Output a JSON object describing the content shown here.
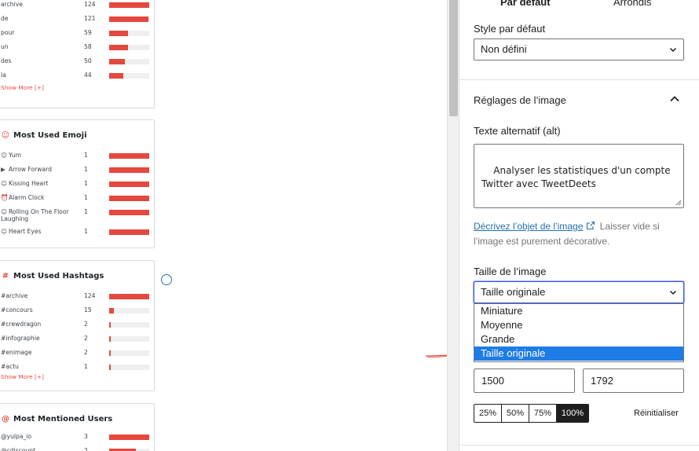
{
  "canvas": {
    "cards": [
      {
        "title": "",
        "rows": [
          {
            "icon": "",
            "label": "archive",
            "count": "124",
            "fill": 1.0
          },
          {
            "icon": "",
            "label": "de",
            "count": "121",
            "fill": 0.98
          },
          {
            "icon": "",
            "label": "pour",
            "count": "59",
            "fill": 0.48
          },
          {
            "icon": "",
            "label": "un",
            "count": "58",
            "fill": 0.47
          },
          {
            "icon": "",
            "label": "des",
            "count": "50",
            "fill": 0.4
          },
          {
            "icon": "",
            "label": "la",
            "count": "44",
            "fill": 0.36
          }
        ],
        "show_more": "Show More [+]"
      },
      {
        "title": "Most Used Emoji",
        "title_icon": "☺",
        "rows": [
          {
            "icon": "☺",
            "label": "Yum",
            "count": "1",
            "fill": 1.0
          },
          {
            "icon": "▶",
            "label": "Arrow Forward",
            "count": "1",
            "fill": 1.0
          },
          {
            "icon": "☺",
            "label": "Kissing Heart",
            "count": "1",
            "fill": 1.0
          },
          {
            "icon": "⏰",
            "label": "Alarm Clock",
            "count": "1",
            "fill": 1.0
          },
          {
            "icon": "☺",
            "label": "Rolling On The Floor Laughing",
            "count": "1",
            "fill": 1.0
          },
          {
            "icon": "☺",
            "label": "Heart Eyes",
            "count": "1",
            "fill": 1.0
          }
        ],
        "show_more": ""
      },
      {
        "title": "Most Used Hashtags",
        "title_icon": "#",
        "rows": [
          {
            "icon": "",
            "label": "#archive",
            "count": "124",
            "fill": 1.0
          },
          {
            "icon": "",
            "label": "#concours",
            "count": "15",
            "fill": 0.12
          },
          {
            "icon": "",
            "label": "#crewdragon",
            "count": "2",
            "fill": 0.03
          },
          {
            "icon": "",
            "label": "#infographie",
            "count": "2",
            "fill": 0.03
          },
          {
            "icon": "",
            "label": "#enimage",
            "count": "2",
            "fill": 0.03
          },
          {
            "icon": "",
            "label": "#actu",
            "count": "1",
            "fill": 0.02
          }
        ],
        "show_more": "Show More [+]"
      },
      {
        "title": "Most Mentioned Users",
        "title_icon": "@",
        "rows": [
          {
            "icon": "",
            "label": "@yulpa_io",
            "count": "3",
            "fill": 1.0
          },
          {
            "icon": "",
            "label": "@cdiscount",
            "count": "2",
            "fill": 0.67
          }
        ],
        "show_more": ""
      }
    ]
  },
  "sidebar": {
    "tabs": {
      "active": "Par défaut",
      "inactive": "Arrondis"
    },
    "style": {
      "label": "Style par défaut",
      "value": "Non défini"
    },
    "panel": {
      "title": "Réglages de l’image",
      "alt_label": "Texte alternatif (alt)",
      "alt_value": "Analyser les statistiques d'un compte Twitter avec TweetDeets",
      "help_link": "Décrivez l’objet de l’image",
      "help_text": " Laisser vide si l’image est purement décorative.",
      "size_label": "Taille de l’image",
      "size_value": "Taille originale",
      "size_options": [
        "Miniature",
        "Moyenne",
        "Grande",
        "Taille originale"
      ],
      "selected_index": 3,
      "width": "1500",
      "height": "1792",
      "percents": [
        "25%",
        "50%",
        "75%",
        "100%"
      ],
      "active_percent": "100%",
      "reset_label": "Réinitialiser"
    }
  },
  "colors": {
    "accent_red": "#e5483f",
    "wp_blue": "#2271b1",
    "focus_blue": "#3858e9",
    "selection_blue": "#1e7ce6"
  }
}
